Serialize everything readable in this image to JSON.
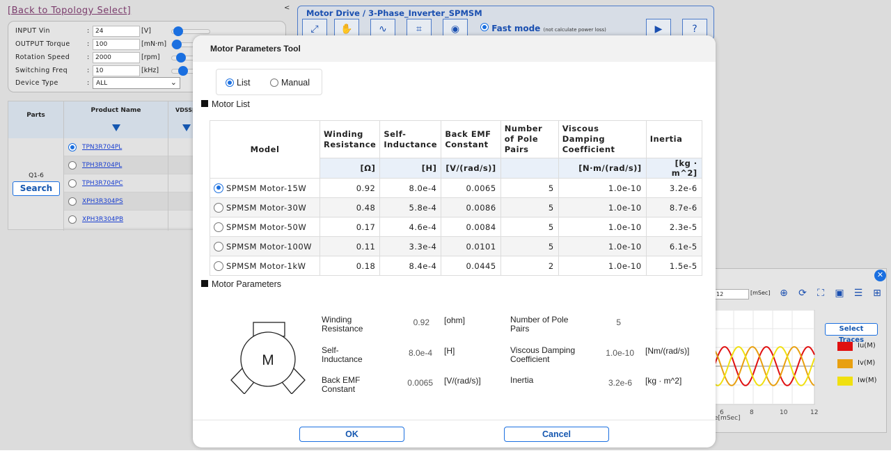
{
  "left_panel": {
    "back_link": "[Back to Topology Select]",
    "collapse_glyph": "<",
    "inputs": [
      {
        "label": "INPUT Vin",
        "value": "24",
        "unit": "[V]",
        "slider_level": 0.1
      },
      {
        "label": "OUTPUT Torque",
        "value": "100",
        "unit": "[mN·m]",
        "slider_level": 0.05
      },
      {
        "label": "Rotation Speed",
        "value": "2000",
        "unit": "[rpm]",
        "slider_level": 0.2
      },
      {
        "label": "Switching Freq",
        "value": "10",
        "unit": "[kHz]",
        "slider_level": 0.25
      }
    ],
    "device_type": {
      "label": "Device Type",
      "value": "ALL"
    },
    "parts_table": {
      "headers": [
        "Parts",
        "Product Name",
        "VDSS["
      ],
      "group_label": "Q1-6",
      "search_label": "Search",
      "products": [
        "TPN3R704PL",
        "TPH3R704PL",
        "TPH3R704PC",
        "XPH3R304PS",
        "XPH3R304PB"
      ],
      "selected_index": 0
    }
  },
  "top_panel": {
    "title": "Motor Drive / 3-Phase_Inverter_SPMSM",
    "fast_mode_label": "Fast mode",
    "fast_mode_note": "(not calculate power loss)",
    "help_glyph": "?"
  },
  "wave_window": {
    "time_value": "12",
    "time_unit": "[mSec]",
    "select_traces_label": "Select Traces",
    "traces": [
      {
        "name": "Iu(M)",
        "color": "#e01010"
      },
      {
        "name": "Iv(M)",
        "color": "#e8a010"
      },
      {
        "name": "Iw(M)",
        "color": "#f0e010"
      }
    ],
    "x_ticks": [
      "6",
      "8",
      "10",
      "12"
    ],
    "x_axis_label": "e[mSec]"
  },
  "dialog": {
    "title": "Motor Parameters Tool",
    "mode_options": [
      "List",
      "Manual"
    ],
    "selected_mode": "List",
    "motor_list_heading": "Motor List",
    "columns": [
      {
        "header": "Model",
        "unit": ""
      },
      {
        "header": "Winding Resistance",
        "unit": "[Ω]"
      },
      {
        "header": "Self-Inductance",
        "unit": "[H]"
      },
      {
        "header": "Back EMF Constant",
        "unit": "[V/(rad/s)]"
      },
      {
        "header": "Number of Pole Pairs",
        "unit": ""
      },
      {
        "header": "Viscous Damping Coefficient",
        "unit": "[N·m/(rad/s)]"
      },
      {
        "header": "Inertia",
        "unit": "[kg · m^2]"
      }
    ],
    "motors": [
      {
        "model": "SPMSM Motor-15W",
        "resistance": "0.92",
        "inductance": "8.0e-4",
        "emf": "0.0065",
        "poles": "5",
        "damping": "1.0e-10",
        "inertia": "3.2e-6",
        "selected": true
      },
      {
        "model": "SPMSM Motor-30W",
        "resistance": "0.48",
        "inductance": "5.8e-4",
        "emf": "0.0086",
        "poles": "5",
        "damping": "1.0e-10",
        "inertia": "8.7e-6",
        "selected": false
      },
      {
        "model": "SPMSM Motor-50W",
        "resistance": "0.17",
        "inductance": "4.6e-4",
        "emf": "0.0084",
        "poles": "5",
        "damping": "1.0e-10",
        "inertia": "2.3e-5",
        "selected": false
      },
      {
        "model": "SPMSM Motor-100W",
        "resistance": "0.11",
        "inductance": "3.3e-4",
        "emf": "0.0101",
        "poles": "5",
        "damping": "1.0e-10",
        "inertia": "6.1e-5",
        "selected": false
      },
      {
        "model": "SPMSM Motor-1kW",
        "resistance": "0.18",
        "inductance": "8.4e-4",
        "emf": "0.0445",
        "poles": "2",
        "damping": "1.0e-10",
        "inertia": "1.5e-5",
        "selected": false
      }
    ],
    "motor_params_heading": "Motor Parameters",
    "motor_symbol": "M",
    "params": {
      "resistance": {
        "label": "Winding Resistance",
        "value": "0.92",
        "unit": "[ohm]"
      },
      "inductance": {
        "label": "Self-Inductance",
        "value": "8.0e-4",
        "unit": "[H]"
      },
      "emf": {
        "label": "Back EMF Constant",
        "value": "0.0065",
        "unit": "[V/(rad/s)]"
      },
      "poles": {
        "label": "Number of Pole Pairs",
        "value": "5",
        "unit": ""
      },
      "damping": {
        "label": "Viscous Damping Coefficient",
        "value": "1.0e-10",
        "unit": "[Nm/(rad/s)]"
      },
      "inertia": {
        "label": "Inertia",
        "value": "3.2e-6",
        "unit": "[kg · m^2]"
      }
    },
    "ok_label": "OK",
    "cancel_label": "Cancel"
  },
  "colors": {
    "accent": "#1a6fe0",
    "link": "#1a3fd0",
    "back_link": "#7a3b6b",
    "panel_border": "#4b7ac9"
  }
}
